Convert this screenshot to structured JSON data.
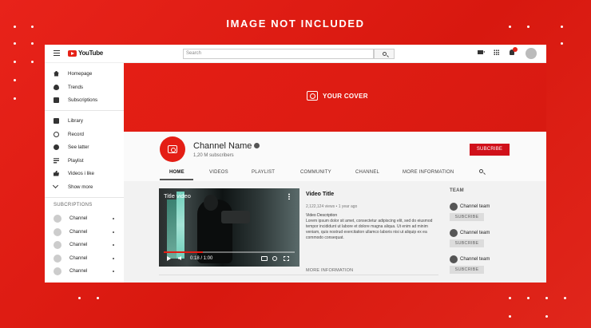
{
  "banner": {
    "text": "IMAGE NOT INCLUDED"
  },
  "header": {
    "logo_text": "YouTube",
    "search_placeholder": "Search",
    "icons": [
      "menu-icon",
      "create-video-icon",
      "apps-icon",
      "notifications-icon",
      "account-avatar"
    ]
  },
  "sidebar": {
    "main_items": [
      {
        "label": "Homepage",
        "icon": "home-icon"
      },
      {
        "label": "Trends",
        "icon": "trending-icon"
      },
      {
        "label": "Subscriptions",
        "icon": "subscriptions-icon"
      }
    ],
    "library_items": [
      {
        "label": "Library",
        "icon": "library-icon"
      },
      {
        "label": "Record",
        "icon": "history-icon"
      },
      {
        "label": "See latter",
        "icon": "watch-later-icon"
      },
      {
        "label": "Playlist",
        "icon": "playlist-icon"
      },
      {
        "label": "Videos i like",
        "icon": "liked-icon"
      },
      {
        "label": "Show more",
        "icon": "chevron-down-icon"
      }
    ],
    "subscriptions_title": "SUBCRIPTIONS",
    "subscriptions": [
      "Channel",
      "Channel",
      "Channel",
      "Channel",
      "Channel"
    ]
  },
  "cover": {
    "text": "YOUR COVER"
  },
  "channel": {
    "name": "Channel Name",
    "subscribers": "1,20 M subscribers",
    "subscribe_label": "SUBCRIBE",
    "tabs": [
      "HOME",
      "VIDEOS",
      "PLAYLIST",
      "COMMUNITY",
      "CHANNEL",
      "MORE INFORMATION"
    ]
  },
  "video": {
    "overlay_title": "Title video",
    "time": "0:18 / 1:00",
    "progress": 0.3,
    "title": "Video Title",
    "views": "2,122,124 views",
    "age": "1 year ago",
    "meta_separator": "•",
    "description_heading": "Video Description",
    "description": "Lorem ipsum dolor sit amet, consectetur adipiscing elit, sed do eiusmod tempor incididunt ut labore et dolore magna aliqua. Ut enim ad minim veniam, quis nostrud exercitation ullamco laboris nisi ut aliquip ex ea commodo consequat.",
    "more_info": "MORE INFORMATION"
  },
  "team": {
    "title": "TEAM",
    "members": [
      {
        "name": "Channel team",
        "button": "SUBCRIBE"
      },
      {
        "name": "Channel team",
        "button": "SUBCRIBE"
      },
      {
        "name": "Channel team",
        "button": "SUBCRIBE"
      }
    ]
  },
  "colors": {
    "brand_red": "#e41e15",
    "subscribe_red": "#d0101a"
  }
}
